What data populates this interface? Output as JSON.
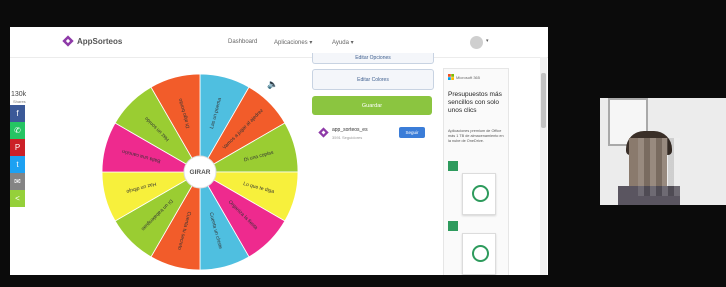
{
  "app": {
    "logo_text": "AppSorteos",
    "brand_color": "#8e3aa8"
  },
  "nav": {
    "dashboard": "Dashboard",
    "applications": "Aplicaciones",
    "help": "Ayuda",
    "caret": "▾"
  },
  "share": {
    "count": "130k",
    "label": "Shares",
    "buttons": [
      {
        "name": "facebook-share-icon",
        "glyph": "f",
        "color": "#3b5998"
      },
      {
        "name": "whatsapp-share-icon",
        "glyph": "✆",
        "color": "#25c463"
      },
      {
        "name": "pinterest-share-icon",
        "glyph": "P",
        "color": "#cb2027"
      },
      {
        "name": "twitter-share-icon",
        "glyph": "t",
        "color": "#1da1f2"
      },
      {
        "name": "email-share-icon",
        "glyph": "✉",
        "color": "#848484"
      },
      {
        "name": "sharethis-share-icon",
        "glyph": "<",
        "color": "#95d03a"
      }
    ]
  },
  "wheel": {
    "spin_label": "GIRAR",
    "segments": [
      {
        "color": "#4fbfe0",
        "text": "Las un poema"
      },
      {
        "color": "#f25c2a",
        "text": "Vamos a jugar al ajedrez"
      },
      {
        "color": "#9acd32",
        "text": "Di una coplas"
      },
      {
        "color": "#f7f03c",
        "text": "Lo que te diga"
      },
      {
        "color": "#ee2a8e",
        "text": "Organiza la fiesta"
      },
      {
        "color": "#4fbfe0",
        "text": "Cuenta un chiste"
      },
      {
        "color": "#f25c2a",
        "text": "Cuenta tu secreto"
      },
      {
        "color": "#9acd32",
        "text": "Di un trabalenguas"
      },
      {
        "color": "#f7f03c",
        "text": "Haz un dibujo"
      },
      {
        "color": "#ee2a8e",
        "text": "Baila una canción"
      },
      {
        "color": "#9acd32",
        "text": "Haz un sonido"
      },
      {
        "color": "#f25c2a",
        "text": "Di algo bonito"
      }
    ]
  },
  "panel": {
    "edit_options": "Editar Opciones",
    "edit_colors": "Editar Colores",
    "save": "Guardar",
    "user_name": "app_sorteos_es",
    "user_sub": "3591 Seguidores",
    "follow": "Seguir"
  },
  "ad": {
    "brand": "Microsoft 365",
    "title": "Presupuestos más sencillos con solo unos clics",
    "body": "Aplicaciones premium de Office más 1 TB de almacenamiento en la nube de OneDrive."
  },
  "sound_icon": "🔈"
}
